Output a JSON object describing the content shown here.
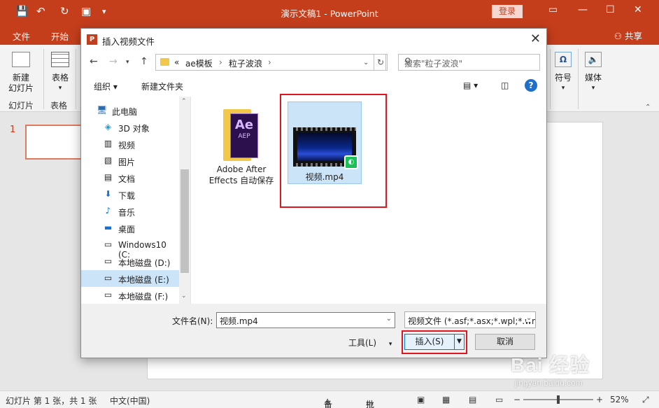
{
  "app": {
    "window_title": "演示文稿1  -  PowerPoint",
    "login": "登录",
    "share": "共享",
    "tabs": [
      "文件",
      "开始"
    ]
  },
  "ribbon": {
    "new_slide": "新建\n幻灯片",
    "slides_group": "幻灯片",
    "table": "表格",
    "tables_group": "表格",
    "symbol": "符号",
    "media": "媒体"
  },
  "thumbnails": {
    "slide_number": "1"
  },
  "dialog": {
    "title": "插入视频文件",
    "path": [
      "ae模板",
      "粒子波浪"
    ],
    "path_prefix": "«",
    "search_placeholder": "搜索\"粒子波浪\"",
    "toolbar": {
      "organize": "组织 ▾",
      "new_folder": "新建文件夹"
    },
    "nav_items": [
      {
        "icon": "computer-icon",
        "label": "此电脑"
      },
      {
        "icon": "3d-objects-icon",
        "label": "3D 对象"
      },
      {
        "icon": "video-folder-icon",
        "label": "视频"
      },
      {
        "icon": "pictures-icon",
        "label": "图片"
      },
      {
        "icon": "documents-icon",
        "label": "文档"
      },
      {
        "icon": "downloads-icon",
        "label": "下载"
      },
      {
        "icon": "music-icon",
        "label": "音乐"
      },
      {
        "icon": "desktop-icon",
        "label": "桌面"
      },
      {
        "icon": "drive-icon",
        "label": "Windows10 (C:"
      },
      {
        "icon": "drive-icon",
        "label": "本地磁盘 (D:)"
      },
      {
        "icon": "drive-icon",
        "label": "本地磁盘 (E:)"
      },
      {
        "icon": "drive-icon",
        "label": "本地磁盘 (F:)"
      }
    ],
    "selected_nav_index": 10,
    "files": [
      {
        "name_line1": "Adobe After",
        "name_line2": "Effects 自动保存",
        "icon": "ae-folder-icon",
        "badge": "Ae",
        "sub": "AEP"
      },
      {
        "name_line1": "视频.mp4",
        "icon": "video-file-icon"
      }
    ],
    "filename_label": "文件名(N):",
    "filename_value": "视频.mp4",
    "filetype_value": "视频文件 (*.asf;*.asx;*.wpl;*.wm",
    "tools_label": "工具(L)",
    "insert_label": "插入(S)",
    "cancel_label": "取消"
  },
  "statusbar": {
    "slide_info": "幻灯片 第 1 张，共 1 张",
    "language": "中文(中国)",
    "notes": "备注",
    "comments": "批注",
    "zoom": "52%"
  },
  "watermark": {
    "brand": "Bai 经验",
    "url": "jingyan.baidu.com"
  },
  "colors": {
    "accent": "#c43e1c",
    "selection": "#cce4f7",
    "highlight_box": "#e0161e"
  }
}
